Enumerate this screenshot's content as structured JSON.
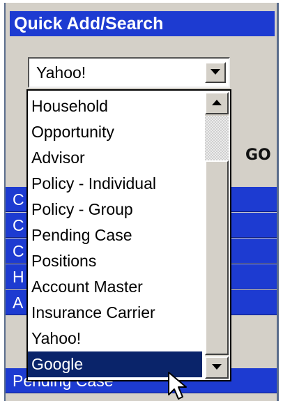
{
  "panel": {
    "title": "Quick Add/Search",
    "combo": {
      "selected_value": "Yahoo!"
    },
    "go_label": "GO",
    "background_rows": [
      "C",
      "C",
      "C",
      "H",
      "A",
      "Pending Case"
    ]
  },
  "dropdown": {
    "items": [
      "Household",
      "Opportunity",
      "Advisor",
      "Policy - Individual",
      "Policy - Group",
      "Pending Case",
      "Positions",
      "Account Master",
      "Insurance Carrier",
      "Yahoo!",
      "Google"
    ],
    "highlighted_item": "Google"
  },
  "colors": {
    "header_blue": "#1d3bd1",
    "selection_navy": "#0a246a",
    "panel_gray": "#d4d0c8"
  },
  "icons": {
    "combo_arrow": "triangle-down-icon",
    "scroll_up": "triangle-up-icon",
    "scroll_down": "triangle-down-icon",
    "cursor": "mouse-pointer-icon"
  }
}
